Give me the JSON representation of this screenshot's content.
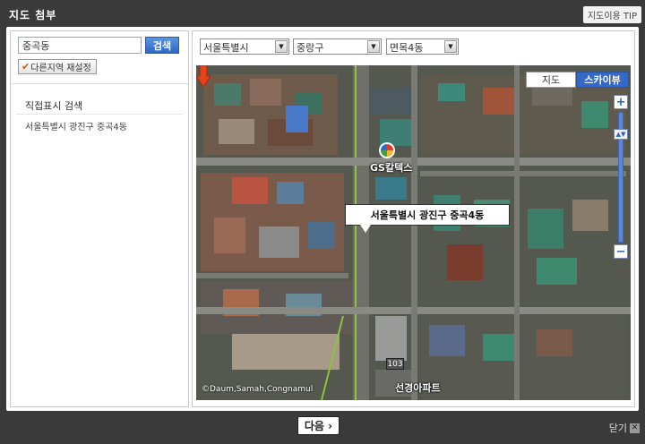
{
  "header": {
    "title": "지도 첨부",
    "tip_label": "지도이용 TIP"
  },
  "left_panel": {
    "search_value": "중곡동",
    "search_button": "검색",
    "reset_button": "다른지역 재설정",
    "direct_label": "직접표시 검색",
    "address": "서울특별시 광진구 중곡4동"
  },
  "selects": {
    "city": "서울특별시",
    "district": "중랑구",
    "dong": "면목4동"
  },
  "map": {
    "type_map": "지도",
    "type_sky": "스카이뷰",
    "selected_type": "스카이뷰",
    "zoom_in": "+",
    "zoom_out": "−",
    "poi_gs": "GS칼텍스",
    "callout": "서울특별시 광진구 중곡4동",
    "road_number": "103",
    "poi_apartment": "선경아파트",
    "copyright": "©Daum,Samah,Congnamul",
    "colors": {
      "sky_button": "#3469c8",
      "marker": "#e8421c"
    }
  },
  "footer": {
    "next_button": "다음 ›",
    "close_label": "닫기",
    "close_icon": "✕"
  }
}
